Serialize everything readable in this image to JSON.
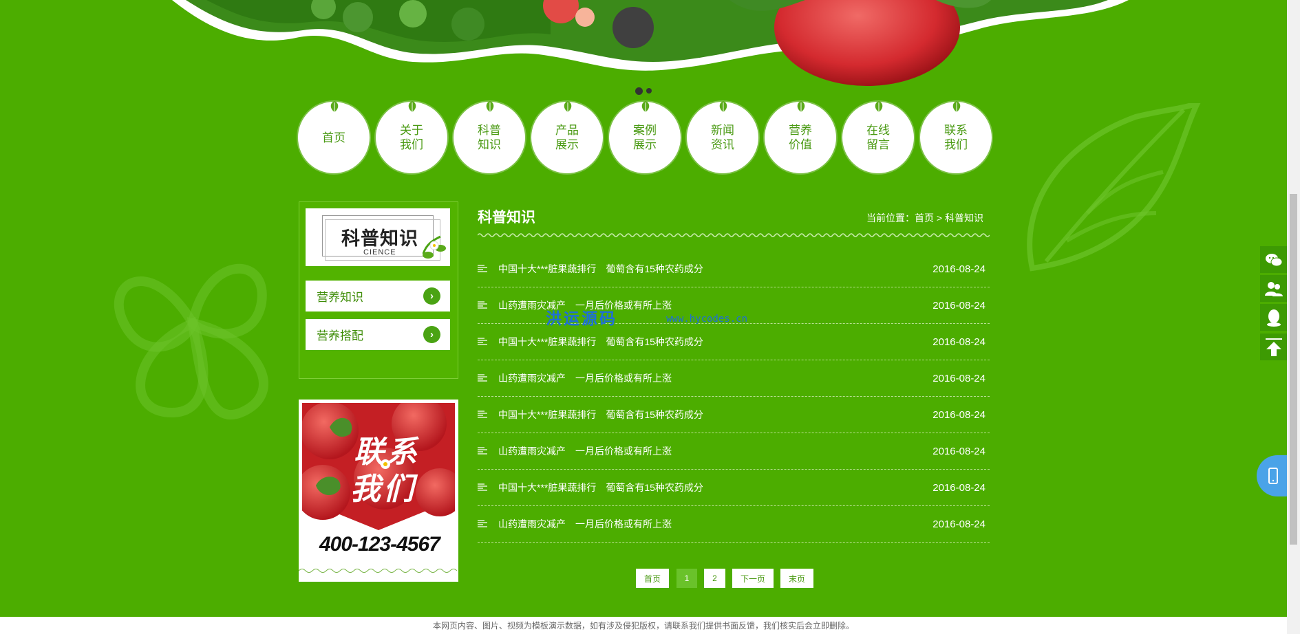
{
  "nav": {
    "items": [
      {
        "label": "首页"
      },
      {
        "label": "关于\n我们"
      },
      {
        "label": "科普\n知识"
      },
      {
        "label": "产品\n展示"
      },
      {
        "label": "案例\n展示"
      },
      {
        "label": "新闻\n资讯"
      },
      {
        "label": "营养\n价值"
      },
      {
        "label": "在线\n留言"
      },
      {
        "label": "联系\n我们"
      }
    ]
  },
  "sidebar": {
    "title": "科普知识",
    "subtitle": "CIENCE",
    "items": [
      {
        "label": "营养知识"
      },
      {
        "label": "营养搭配"
      }
    ],
    "contact": {
      "heading_line1": "联系",
      "heading_line2": "我们",
      "phone": "400-123-4567"
    }
  },
  "content": {
    "title": "科普知识",
    "breadcrumb": "当前位置：首页 > 科普知识",
    "articles": [
      {
        "title": "中国十大***脏果蔬排行　葡萄含有15种农药成分",
        "date": "2016-08-24"
      },
      {
        "title": "山药遭雨灾减产　一月后价格或有所上涨",
        "date": "2016-08-24"
      },
      {
        "title": "中国十大***脏果蔬排行　葡萄含有15种农药成分",
        "date": "2016-08-24"
      },
      {
        "title": "山药遭雨灾减产　一月后价格或有所上涨",
        "date": "2016-08-24"
      },
      {
        "title": "中国十大***脏果蔬排行　葡萄含有15种农药成分",
        "date": "2016-08-24"
      },
      {
        "title": "山药遭雨灾减产　一月后价格或有所上涨",
        "date": "2016-08-24"
      },
      {
        "title": "中国十大***脏果蔬排行　葡萄含有15种农药成分",
        "date": "2016-08-24"
      },
      {
        "title": "山药遭雨灾减产　一月后价格或有所上涨",
        "date": "2016-08-24"
      }
    ]
  },
  "pagination": {
    "first": "首页",
    "page1": "1",
    "page2": "2",
    "next": "下一页",
    "last": "末页"
  },
  "watermark": {
    "cn": "洪运源码",
    "url": "www.hycodes.cn"
  },
  "footer": {
    "text": "本网页内容、图片、视频为模板演示数据，如有涉及侵犯版权，请联系我们提供书面反馈，我们核实后会立即删除。"
  },
  "float_tools": [
    "wechat-icon",
    "customer-service-icon",
    "qq-icon",
    "back-to-top-icon",
    "mobile-icon"
  ],
  "colors": {
    "background": "#4cad00",
    "nav_text": "#4a9a13",
    "accent_active": "#6ac22a"
  }
}
